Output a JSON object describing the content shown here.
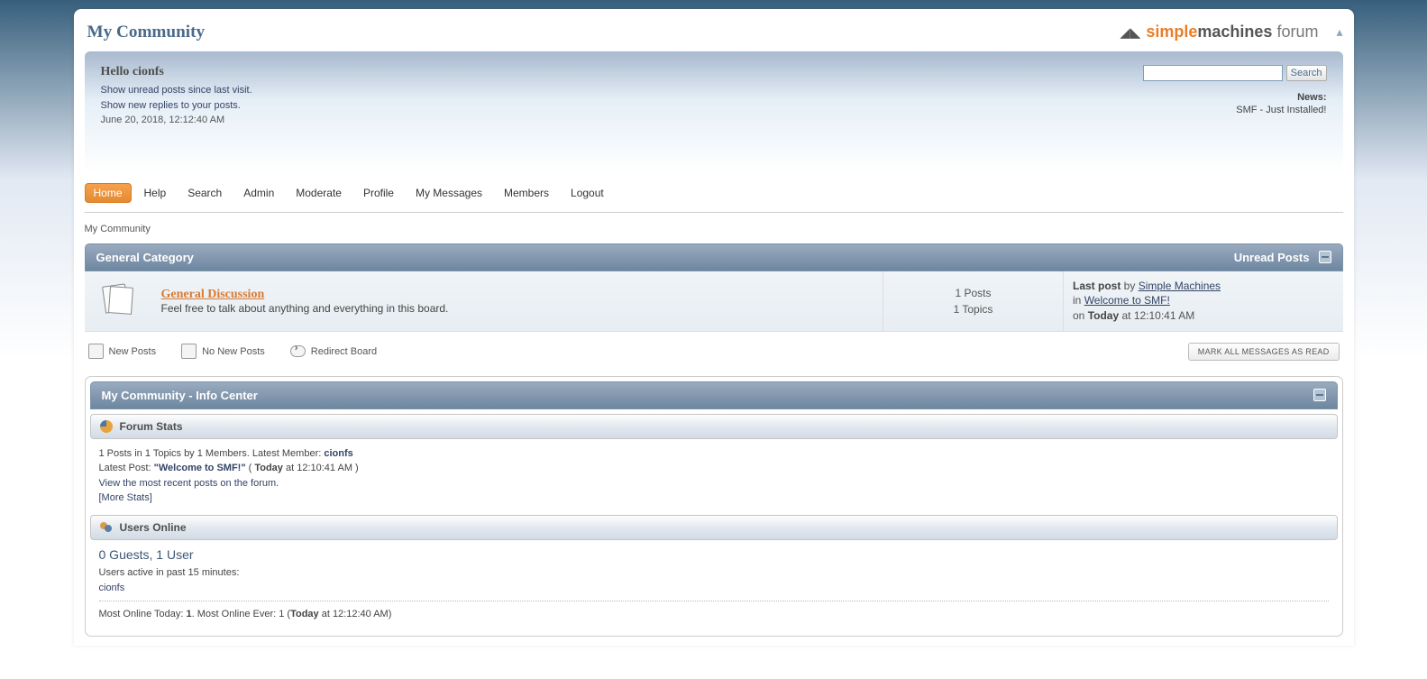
{
  "header": {
    "title": "My Community",
    "logo": {
      "simple": "simple",
      "machines": "machines",
      "forum": " forum"
    }
  },
  "user_panel": {
    "greeting": "Hello cionfs",
    "link_unread": "Show unread posts since last visit.",
    "link_replies": "Show new replies to your posts.",
    "datetime": "June 20, 2018, 12:12:40 AM",
    "news_label": "News:",
    "news_text": "SMF - Just Installed!"
  },
  "search": {
    "button": "Search"
  },
  "menu": {
    "items": [
      "Home",
      "Help",
      "Search",
      "Admin",
      "Moderate",
      "Profile",
      "My Messages",
      "Members",
      "Logout"
    ],
    "active_index": 0
  },
  "breadcrumb": "My Community",
  "category": {
    "title": "General Category",
    "unread_label": "Unread Posts"
  },
  "board": {
    "title": "General Discussion",
    "desc": "Feel free to talk about anything and everything in this board.",
    "posts": "1 Posts",
    "topics": "1 Topics",
    "lastpost_label": "Last post",
    "lastpost_by_prefix": " by ",
    "lastpost_by": "Simple Machines",
    "lastpost_in_prefix": "in ",
    "lastpost_in": "Welcome to SMF!",
    "lastpost_on_prefix": "on ",
    "lastpost_on_bold": "Today",
    "lastpost_on_time": " at 12:10:41 AM"
  },
  "legend": {
    "new": "New Posts",
    "nonew": "No New Posts",
    "redirect": "Redirect Board",
    "mark_read": "Mark All Messages As Read"
  },
  "info_center": {
    "title": "My Community - Info Center",
    "forum_stats_title": "Forum Stats",
    "stats_line_a": "1 Posts in 1 Topics by 1 Members. Latest Member: ",
    "stats_latest_member": "cionfs",
    "latest_post_prefix": "Latest Post: ",
    "latest_post_title": "\"Welcome to SMF!\"",
    "latest_post_paren_open": " ( ",
    "latest_post_today": "Today",
    "latest_post_time": " at 12:10:41 AM )",
    "view_recent": "View the most recent posts on the forum.",
    "more_stats": "[More Stats]",
    "users_online_title": "Users Online",
    "users_online_count": "0 Guests, 1 User",
    "users_active_label": "Users active in past 15 minutes:",
    "users_active_list": "cionfs",
    "most_online_a": "Most Online Today: ",
    "most_online_today": "1",
    "most_online_b": ". Most Online Ever: 1 (",
    "most_online_ever_bold": "Today",
    "most_online_c": " at 12:12:40 AM)"
  }
}
